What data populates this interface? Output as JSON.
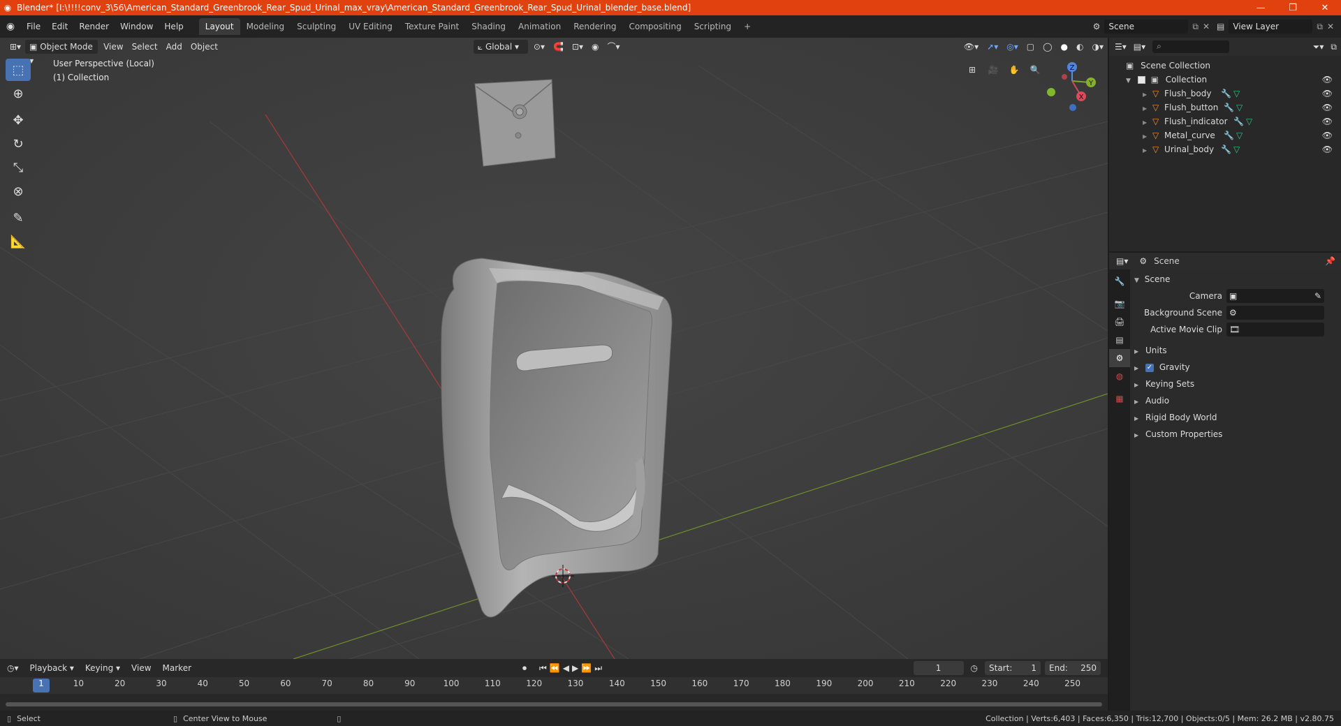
{
  "window": {
    "title": "Blender* [I:\\!!!!conv_3\\56\\American_Standard_Greenbrook_Rear_Spud_Urinal_max_vray\\American_Standard_Greenbrook_Rear_Spud_Urinal_blender_base.blend]",
    "minimize": "—",
    "maximize": "❐",
    "close": "✕"
  },
  "menu": [
    "File",
    "Edit",
    "Render",
    "Window",
    "Help"
  ],
  "workspaces": [
    "Layout",
    "Modeling",
    "Sculpting",
    "UV Editing",
    "Texture Paint",
    "Shading",
    "Animation",
    "Rendering",
    "Compositing",
    "Scripting",
    "+"
  ],
  "active_workspace": "Layout",
  "scene_selector": {
    "label": "Scene"
  },
  "view_layer_selector": {
    "label": "View Layer"
  },
  "viewport": {
    "mode": "Object Mode",
    "menus": [
      "View",
      "Select",
      "Add",
      "Object"
    ],
    "transform_orientation": "Global",
    "info_line1": "User Perspective (Local)",
    "info_line2": "(1) Collection",
    "gizmo": {
      "x": "X",
      "y": "Y",
      "z": "Z"
    }
  },
  "outliner": {
    "search_placeholder": "",
    "root": "Scene Collection",
    "collection": "Collection",
    "objects": [
      "Flush_body",
      "Flush_button",
      "Flush_indicator",
      "Metal_curve",
      "Urinal_body"
    ]
  },
  "properties": {
    "context": "Scene",
    "panel_title": "Scene",
    "fields": [
      {
        "label": "Camera",
        "value": ""
      },
      {
        "label": "Background Scene",
        "value": ""
      },
      {
        "label": "Active Movie Clip",
        "value": ""
      }
    ],
    "subpanels": [
      "Units",
      "Gravity",
      "Keying Sets",
      "Audio",
      "Rigid Body World",
      "Custom Properties"
    ],
    "gravity_checked": true
  },
  "timeline": {
    "menus": [
      "Playback",
      "Keying",
      "View",
      "Marker"
    ],
    "current_frame": "1",
    "start_label": "Start:",
    "start": "1",
    "end_label": "End:",
    "end": "250",
    "ticks": [
      "1",
      "10",
      "20",
      "30",
      "40",
      "50",
      "60",
      "70",
      "80",
      "90",
      "100",
      "110",
      "120",
      "130",
      "140",
      "150",
      "160",
      "170",
      "180",
      "190",
      "200",
      "210",
      "220",
      "230",
      "240",
      "250"
    ]
  },
  "statusbar": {
    "select": "Select",
    "center": "Center View to Mouse",
    "stats": "Collection | Verts:6,403 | Faces:6,350 | Tris:12,700 | Objects:0/5 | Mem: 26.2 MB | v2.80.75"
  }
}
